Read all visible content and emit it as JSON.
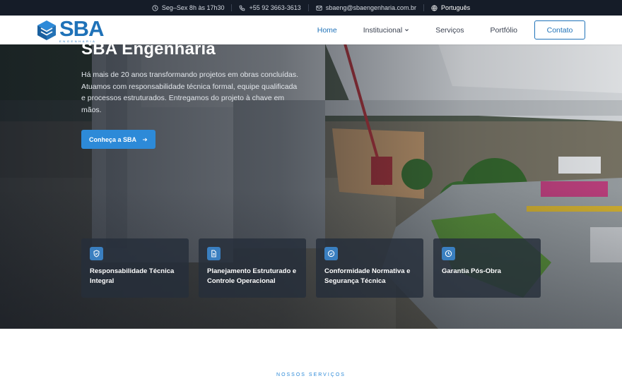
{
  "topbar": {
    "hours": "Seg–Sex 8h às 17h30",
    "phone": "+55 92 3663-3613",
    "email": "sbaeng@sbaengenharia.com.br",
    "language": "Português"
  },
  "header": {
    "logo_text": "SBA",
    "logo_subtext": "ENGENHARIA",
    "nav": [
      {
        "label": "Home",
        "active": true
      },
      {
        "label": "Institucional",
        "has_dropdown": true
      },
      {
        "label": "Serviços"
      },
      {
        "label": "Portfólio"
      }
    ],
    "contact_label": "Contato"
  },
  "hero": {
    "title": "SBA Engenharia",
    "description": "Há mais de 20 anos transformando projetos em obras concluídas. Atuamos com responsabilidade técnica formal, equipe qualificada e processos estruturados. Entregamos do projeto à chave em mãos.",
    "cta_label": "Conheça a SBA",
    "cards": [
      {
        "title": "Responsabilidade Técnica Integral",
        "icon": "shield-icon"
      },
      {
        "title": "Planejamento Estruturado e Controle Operacional",
        "icon": "document-icon"
      },
      {
        "title": "Conformidade Normativa e Segurança Técnica",
        "icon": "check-badge-icon"
      },
      {
        "title": "Garantia Pós-Obra",
        "icon": "clock-icon"
      }
    ]
  },
  "services": {
    "kicker": "NOSSOS SERVIÇOS"
  },
  "colors": {
    "brand": "#1f72b8",
    "accent": "#2d8ad8",
    "topbar_bg": "#151c28"
  }
}
